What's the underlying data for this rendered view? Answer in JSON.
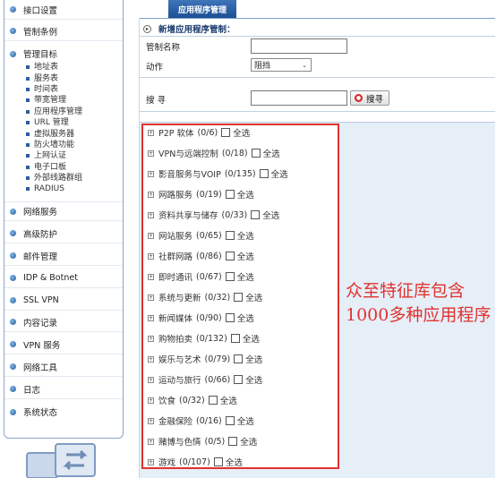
{
  "sidebar": {
    "top_items": [
      {
        "label": "接口设置"
      },
      {
        "label": "管制条例"
      },
      {
        "label": "管理目标"
      }
    ],
    "sub_items": [
      "地址表",
      "服务表",
      "时间表",
      "带宽管理",
      "应用程序管理",
      "URL 管理",
      "虚拟服务器",
      "防火墙功能",
      "上网认证",
      "电子口板",
      "外部线路群组",
      "RADIUS"
    ],
    "bottom_items": [
      {
        "label": "网络服务"
      },
      {
        "label": "高级防护"
      },
      {
        "label": "邮件管理"
      },
      {
        "label": "IDP & Botnet"
      },
      {
        "label": "SSL VPN"
      },
      {
        "label": "内容记录"
      },
      {
        "label": "VPN 服务"
      },
      {
        "label": "网络工具"
      },
      {
        "label": "日志"
      },
      {
        "label": "系统状态"
      }
    ]
  },
  "tab": {
    "label": "应用程序管理"
  },
  "form": {
    "header": "新增应用程序管制：",
    "name_label": "管制名称",
    "name_value": "",
    "action_label": "动作",
    "action_value": "阻挡",
    "search_label": "搜 寻",
    "search_value": "",
    "search_button": "搜寻"
  },
  "categories": [
    {
      "name": "P2P 软体",
      "count": "(0/6)"
    },
    {
      "name": "VPN与远端控制",
      "count": "(0/18)"
    },
    {
      "name": "影音服务与VOIP",
      "count": "(0/135)"
    },
    {
      "name": "网路服务",
      "count": "(0/19)"
    },
    {
      "name": "资料共享与储存",
      "count": "(0/33)"
    },
    {
      "name": "网站服务",
      "count": "(0/65)"
    },
    {
      "name": "社群网路",
      "count": "(0/86)"
    },
    {
      "name": "即时通讯",
      "count": "(0/67)"
    },
    {
      "name": "系统与更新",
      "count": "(0/32)"
    },
    {
      "name": "新闻媒体",
      "count": "(0/90)"
    },
    {
      "name": "购物拍卖",
      "count": "(0/132)"
    },
    {
      "name": "娱乐与艺术",
      "count": "(0/79)"
    },
    {
      "name": "运动与旅行",
      "count": "(0/66)"
    },
    {
      "name": "饮食",
      "count": "(0/32)"
    },
    {
      "name": "金融保险",
      "count": "(0/16)"
    },
    {
      "name": "赌博与色情",
      "count": "(0/5)"
    },
    {
      "name": "游戏",
      "count": "(0/107)"
    }
  ],
  "select_all_label": "全选",
  "annotation": "众至特征库包含1000多种应用程序",
  "colors": {
    "accent": "#1d4f93",
    "highlight": "#e0332e",
    "panel": "#e6eef8"
  },
  "icons": {
    "bullet": "sidebar-bullet-icon",
    "expand": "plus-icon",
    "search": "search-dot-icon",
    "logo": "swap-arrows-icon"
  }
}
